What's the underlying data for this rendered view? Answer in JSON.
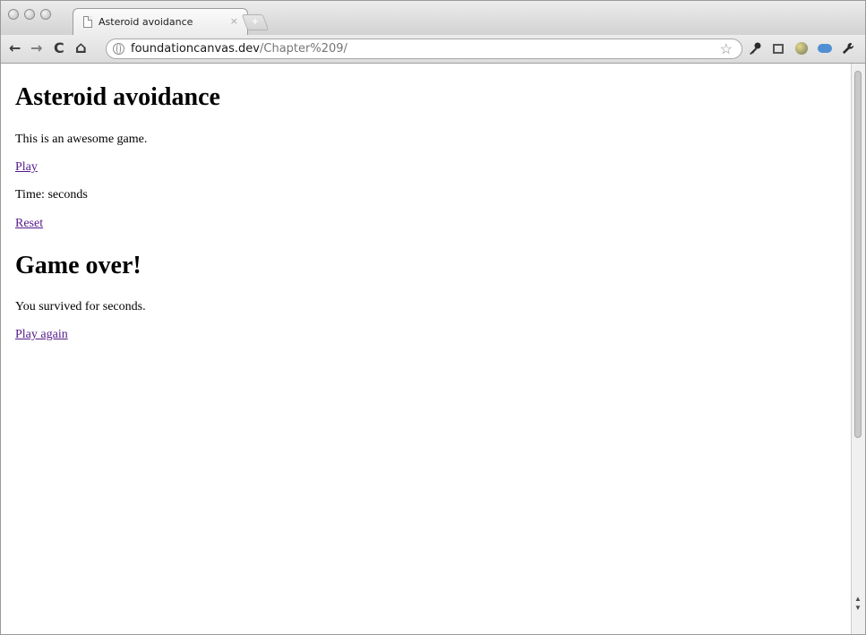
{
  "browser": {
    "tab_title": "Asteroid avoidance",
    "tab_close": "×",
    "new_tab": "+",
    "url_host": "foundationcanvas.dev",
    "url_path": "/Chapter%209/",
    "icons": {
      "back": "←",
      "forward": "→",
      "reload": "C",
      "home": "⌂",
      "bookmark_star": "☆",
      "wrench": "🔧"
    }
  },
  "page": {
    "title": "Asteroid avoidance",
    "intro": "This is an awesome game.",
    "play_link": "Play",
    "time_text": "Time: seconds",
    "reset_link": "Reset",
    "game_over_heading": "Game over!",
    "survived_text": "You survived for seconds.",
    "play_again_link": "Play again",
    "link_color": "#551a8b"
  }
}
